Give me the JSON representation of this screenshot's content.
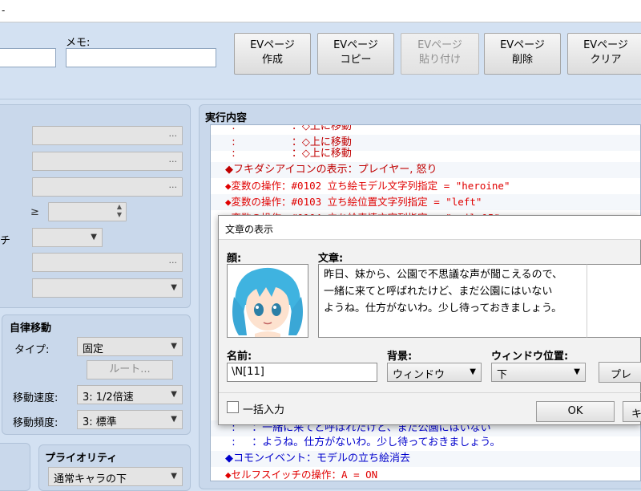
{
  "top": {
    "window_title": "-",
    "memo_label": "メモ:",
    "name_value": "",
    "memo_value": "",
    "buttons": [
      {
        "line1": "EVページ",
        "line2": "作成"
      },
      {
        "line1": "EVページ",
        "line2": "コピー"
      },
      {
        "line1": "EVページ",
        "line2": "貼り付け"
      },
      {
        "line1": "EVページ",
        "line2": "削除"
      },
      {
        "line1": "EVページ",
        "line2": "クリア"
      }
    ]
  },
  "conditions": {
    "field_dots": "...",
    "ge_symbol": "≥",
    "chi_label": "チ"
  },
  "autonomous": {
    "heading": "自律移動",
    "type_label": "タイプ:",
    "type_value": "固定",
    "route_button": "ルート...",
    "speed_label": "移動速度:",
    "speed_value": "3: 1/2倍速",
    "freq_label": "移動頻度:",
    "freq_value": "3: 標準"
  },
  "priority": {
    "heading": "プライオリティ",
    "value": "通常キャラの下"
  },
  "commands": {
    "heading": "実行内容",
    "rows": [
      {
        "text": "  :                 ：◇上に移動",
        "color": "#c00000"
      },
      {
        "text": "  :                 ：◇上に移動",
        "color": "#c00000"
      },
      {
        "text": "  :                 ：◇上に移動",
        "color": "#c00000"
      },
      {
        "text": "◆フキダシアイコンの表示：プレイヤー, 怒り",
        "color": "#c00000"
      },
      {
        "text": "◆変数の操作：#0102 立ち絵モデル文字列指定 = \"heroine\"",
        "color": "#e00000"
      },
      {
        "text": "◆変数の操作：#0103 立ち絵位置文字列指定 = \"left\"",
        "color": "#e00000"
      },
      {
        "text": "◆変数の操作：#0104 立ち絵表情文字列指定 = \"smile15\"",
        "color": "#e00000"
      },
      {
        "text": "  :     ：一緒に来てと呼ばれたけど、まだ公園にはいない",
        "color": "#0000cc"
      },
      {
        "text": "  :     ：ようね。仕方がないわ。少し待っておきましょう。",
        "color": "#0000cc"
      },
      {
        "text": "◆コモンイベント：モデルの立ち絵消去",
        "color": "#0000cc"
      },
      {
        "text": "◆セルフスイッチの操作：A = ON",
        "color": "#e00000"
      }
    ]
  },
  "dialog": {
    "title": "文章の表示",
    "face_label": "顔:",
    "text_label": "文章:",
    "text_lines": [
      "昨日、妹から、公園で不思議な声が聞こえるので、",
      "一緒に来てと呼ばれたけど、まだ公園にはいない",
      "ようね。仕方がないわ。少し待っておきましょう。"
    ],
    "name_label": "名前:",
    "name_value": "\\N[11]",
    "bg_label": "背景:",
    "bg_value": "ウィンドウ",
    "pos_label": "ウィンドウ位置:",
    "pos_value": "下",
    "preview_button": "プレ",
    "batch_label": "一括入力",
    "ok_button": "OK",
    "cancel_button": "キ"
  },
  "colors": {
    "background": "#d3e1f2",
    "panel": "#c9d8eb",
    "command_red": "#e00000",
    "command_blue": "#0000cc"
  }
}
